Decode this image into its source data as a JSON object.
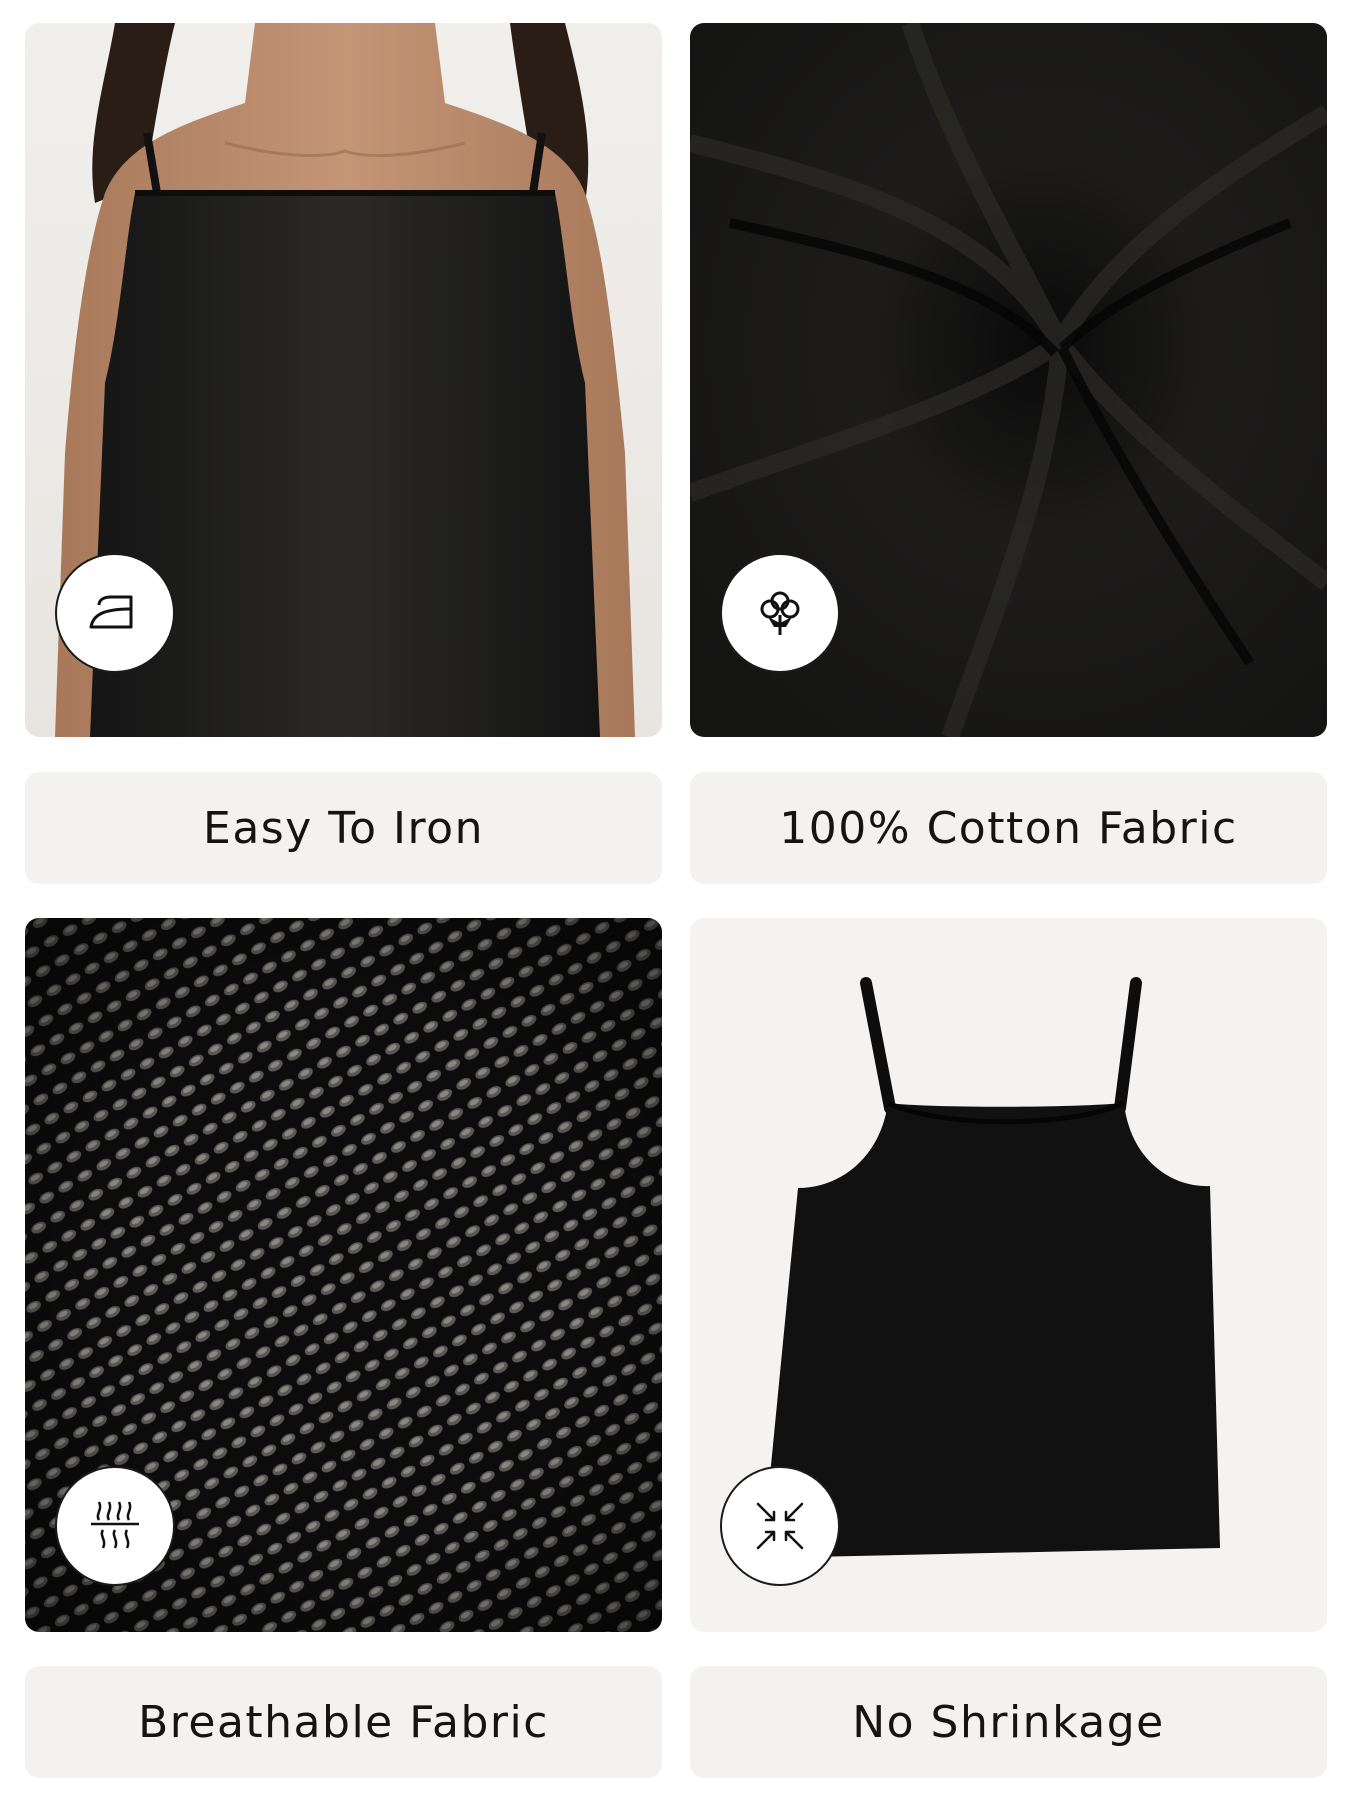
{
  "features": [
    {
      "label": "Easy To Iron",
      "icon": "iron-icon"
    },
    {
      "label": "100% Cotton Fabric",
      "icon": "cotton-flower-icon"
    },
    {
      "label": "Breathable Fabric",
      "icon": "breathable-icon"
    },
    {
      "label": "No Shrinkage",
      "icon": "no-shrink-icon"
    }
  ],
  "colors": {
    "label_background": "#f3f2f1",
    "fabric": "#1a1a1a",
    "skin": "#b98a6c",
    "text": "#141414"
  }
}
